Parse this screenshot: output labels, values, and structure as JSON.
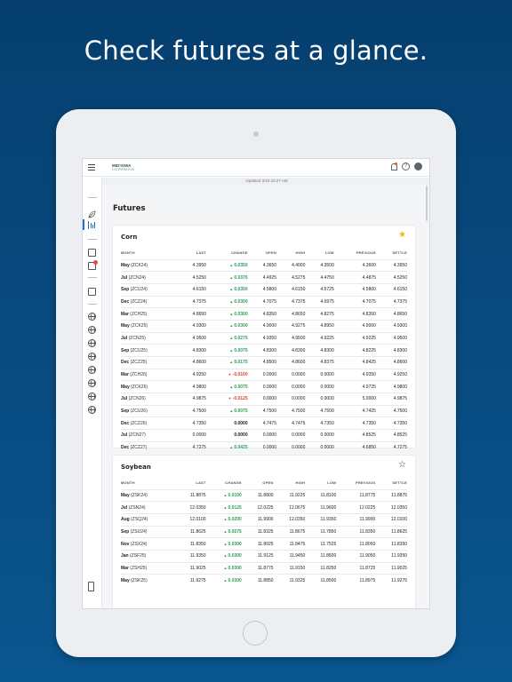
{
  "headline": "Check futures at a glance.",
  "app": {
    "logo_line1": "MID'IOWA",
    "logo_line2": "COOPERATIVE",
    "updated": "Updated 3/19 10:27 AM"
  },
  "page_title": "Futures",
  "columns": [
    "MONTH",
    "LAST",
    "CHANGE",
    "OPEN",
    "HIGH",
    "LOW",
    "PREVIOUS",
    "SETTLE"
  ],
  "colors": {
    "up": "#2e9d58",
    "down": "#e0412f",
    "accent": "#1a73c9",
    "star": "#f1b21c"
  },
  "cards": [
    {
      "title": "Corn",
      "favorite": true,
      "rows": [
        {
          "month": "May",
          "code": "(ZCK24)",
          "last": "4.3950",
          "change": "0.0350",
          "dir": "up",
          "open": "4.3650",
          "high": "4.4000",
          "low": "4.3500",
          "previous": "4.3600",
          "settle": "4.3950"
        },
        {
          "month": "Jul",
          "code": "(ZCN24)",
          "last": "4.5250",
          "change": "0.0375",
          "dir": "up",
          "open": "4.4925",
          "high": "4.5275",
          "low": "4.4750",
          "previous": "4.4875",
          "settle": "4.5250"
        },
        {
          "month": "Sep",
          "code": "(ZCU24)",
          "last": "4.6150",
          "change": "0.0350",
          "dir": "up",
          "open": "4.5800",
          "high": "4.6150",
          "low": "4.5725",
          "previous": "4.5800",
          "settle": "4.6150"
        },
        {
          "month": "Dec",
          "code": "(ZCZ24)",
          "last": "4.7375",
          "change": "0.0300",
          "dir": "up",
          "open": "4.7075",
          "high": "4.7375",
          "low": "4.6975",
          "previous": "4.7075",
          "settle": "4.7375"
        },
        {
          "month": "Mar",
          "code": "(ZCH25)",
          "last": "4.8650",
          "change": "0.0300",
          "dir": "up",
          "open": "4.8350",
          "high": "4.8650",
          "low": "4.8275",
          "previous": "4.8350",
          "settle": "4.8650"
        },
        {
          "month": "May",
          "code": "(ZCK25)",
          "last": "4.9300",
          "change": "0.0300",
          "dir": "up",
          "open": "4.9000",
          "high": "4.9275",
          "low": "4.8950",
          "previous": "4.9000",
          "settle": "4.9300"
        },
        {
          "month": "Jul",
          "code": "(ZCN25)",
          "last": "4.9500",
          "change": "0.0275",
          "dir": "up",
          "open": "4.9350",
          "high": "4.9500",
          "low": "4.9225",
          "previous": "4.9225",
          "settle": "4.9500"
        },
        {
          "month": "Sep",
          "code": "(ZCU25)",
          "last": "4.8300",
          "change": "0.0075",
          "dir": "up",
          "open": "4.8300",
          "high": "4.8300",
          "low": "4.8300",
          "previous": "4.8225",
          "settle": "4.8300"
        },
        {
          "month": "Dec",
          "code": "(ZCZ25)",
          "last": "4.8600",
          "change": "0.0175",
          "dir": "up",
          "open": "4.8500",
          "high": "4.8600",
          "low": "4.8375",
          "previous": "4.8425",
          "settle": "4.8600"
        },
        {
          "month": "Mar",
          "code": "(ZCH26)",
          "last": "4.9250",
          "change": "-0.0100",
          "dir": "down",
          "open": "0.0000",
          "high": "0.0000",
          "low": "0.0000",
          "previous": "4.9350",
          "settle": "4.9250"
        },
        {
          "month": "May",
          "code": "(ZCK26)",
          "last": "4.9800",
          "change": "0.0075",
          "dir": "up",
          "open": "0.0000",
          "high": "0.0000",
          "low": "0.0000",
          "previous": "4.9725",
          "settle": "4.9800"
        },
        {
          "month": "Jul",
          "code": "(ZCN26)",
          "last": "4.9875",
          "change": "-0.0125",
          "dir": "down",
          "open": "0.0000",
          "high": "0.0000",
          "low": "0.0000",
          "previous": "5.0000",
          "settle": "4.9875"
        },
        {
          "month": "Sep",
          "code": "(ZCU26)",
          "last": "4.7500",
          "change": "0.0075",
          "dir": "up",
          "open": "4.7500",
          "high": "4.7500",
          "low": "4.7500",
          "previous": "4.7425",
          "settle": "4.7500"
        },
        {
          "month": "Dec",
          "code": "(ZCZ26)",
          "last": "4.7350",
          "change": "0.0000",
          "dir": "flat",
          "open": "4.7475",
          "high": "4.7475",
          "low": "4.7350",
          "previous": "4.7350",
          "settle": "4.7350"
        },
        {
          "month": "Jul",
          "code": "(ZCN27)",
          "last": "0.0000",
          "change": "0.0000",
          "dir": "flat",
          "open": "0.0000",
          "high": "0.0000",
          "low": "0.0000",
          "previous": "4.8525",
          "settle": "4.8525"
        },
        {
          "month": "Dec",
          "code": "(ZCZ27)",
          "last": "4.7275",
          "change": "0.0425",
          "dir": "up",
          "open": "0.0000",
          "high": "0.0000",
          "low": "0.0000",
          "previous": "4.6850",
          "settle": "4.7275"
        }
      ]
    },
    {
      "title": "Soybean",
      "favorite": false,
      "rows": [
        {
          "month": "May",
          "code": "(ZSK24)",
          "last": "11.8875",
          "change": "0.0100",
          "dir": "up",
          "open": "11.8800",
          "high": "11.9225",
          "low": "11.8100",
          "previous": "11.8775",
          "settle": "11.8875"
        },
        {
          "month": "Jul",
          "code": "(ZSN24)",
          "last": "12.0350",
          "change": "0.0125",
          "dir": "up",
          "open": "12.0225",
          "high": "12.0675",
          "low": "11.9600",
          "previous": "12.0225",
          "settle": "12.0350"
        },
        {
          "month": "Aug",
          "code": "(ZSQ24)",
          "last": "12.0100",
          "change": "0.0200",
          "dir": "up",
          "open": "11.9900",
          "high": "12.0350",
          "low": "11.9350",
          "previous": "11.9900",
          "settle": "12.0100"
        },
        {
          "month": "Sep",
          "code": "(ZSU24)",
          "last": "11.8625",
          "change": "0.0275",
          "dir": "up",
          "open": "11.8325",
          "high": "11.8675",
          "low": "11.7850",
          "previous": "11.8350",
          "settle": "11.8625"
        },
        {
          "month": "Nov",
          "code": "(ZSX24)",
          "last": "11.8350",
          "change": "0.0300",
          "dir": "up",
          "open": "11.8025",
          "high": "11.8475",
          "low": "11.7525",
          "previous": "11.8050",
          "settle": "11.8350"
        },
        {
          "month": "Jan",
          "code": "(ZSF25)",
          "last": "11.9350",
          "change": "0.0300",
          "dir": "up",
          "open": "11.9125",
          "high": "11.9450",
          "low": "11.8600",
          "previous": "11.9050",
          "settle": "11.9350"
        },
        {
          "month": "Mar",
          "code": "(ZSH25)",
          "last": "11.9025",
          "change": "0.0300",
          "dir": "up",
          "open": "11.8775",
          "high": "11.9150",
          "low": "11.8250",
          "previous": "11.8725",
          "settle": "11.9025"
        },
        {
          "month": "May",
          "code": "(ZSK25)",
          "last": "11.9275",
          "change": "0.0300",
          "dir": "up",
          "open": "11.8850",
          "high": "11.9325",
          "low": "11.8500",
          "previous": "11.8975",
          "settle": "11.9275"
        }
      ]
    }
  ]
}
